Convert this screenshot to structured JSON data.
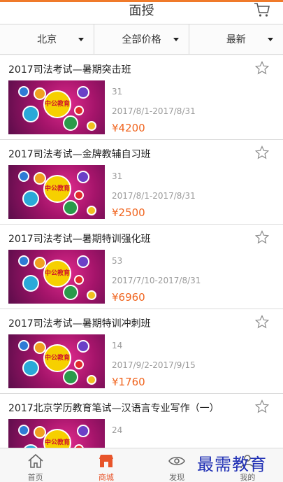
{
  "header": {
    "title": "面授",
    "cart_icon": "cart-icon"
  },
  "filters": [
    {
      "label": "北京",
      "icon": "caret-down-icon"
    },
    {
      "label": "全部价格",
      "icon": "caret-down-icon"
    },
    {
      "label": "最新",
      "icon": "caret-down-icon"
    }
  ],
  "thumbnail": {
    "center_text": "中公教育"
  },
  "courses": [
    {
      "title": "2017司法考试—暑期突击班",
      "count": "31",
      "dates": "2017/8/1-2017/8/31",
      "price": "¥4200"
    },
    {
      "title": "2017司法考试—金牌教辅自习班",
      "count": "31",
      "dates": "2017/8/1-2017/8/31",
      "price": "¥2500"
    },
    {
      "title": "2017司法考试—暑期特训强化班",
      "count": "53",
      "dates": "2017/7/10-2017/8/31",
      "price": "¥6960"
    },
    {
      "title": "2017司法考试—暑期特训冲刺班",
      "count": "14",
      "dates": "2017/9/2-2017/9/15",
      "price": "¥1760"
    },
    {
      "title": "2017北京学历教育笔试—汉语言专业写作（一）",
      "count": "24",
      "dates": "",
      "price": ""
    }
  ],
  "tabs": [
    {
      "label": "首页",
      "icon": "home-icon"
    },
    {
      "label": "商城",
      "icon": "shop-icon"
    },
    {
      "label": "发现",
      "icon": "eye-icon"
    },
    {
      "label": "我的",
      "icon": "user-icon"
    }
  ],
  "watermark": "最需教育",
  "colors": {
    "accent": "#f07a2a",
    "price": "#f0641e",
    "active_tab": "#e8542a",
    "watermark": "#1f2fb4"
  }
}
